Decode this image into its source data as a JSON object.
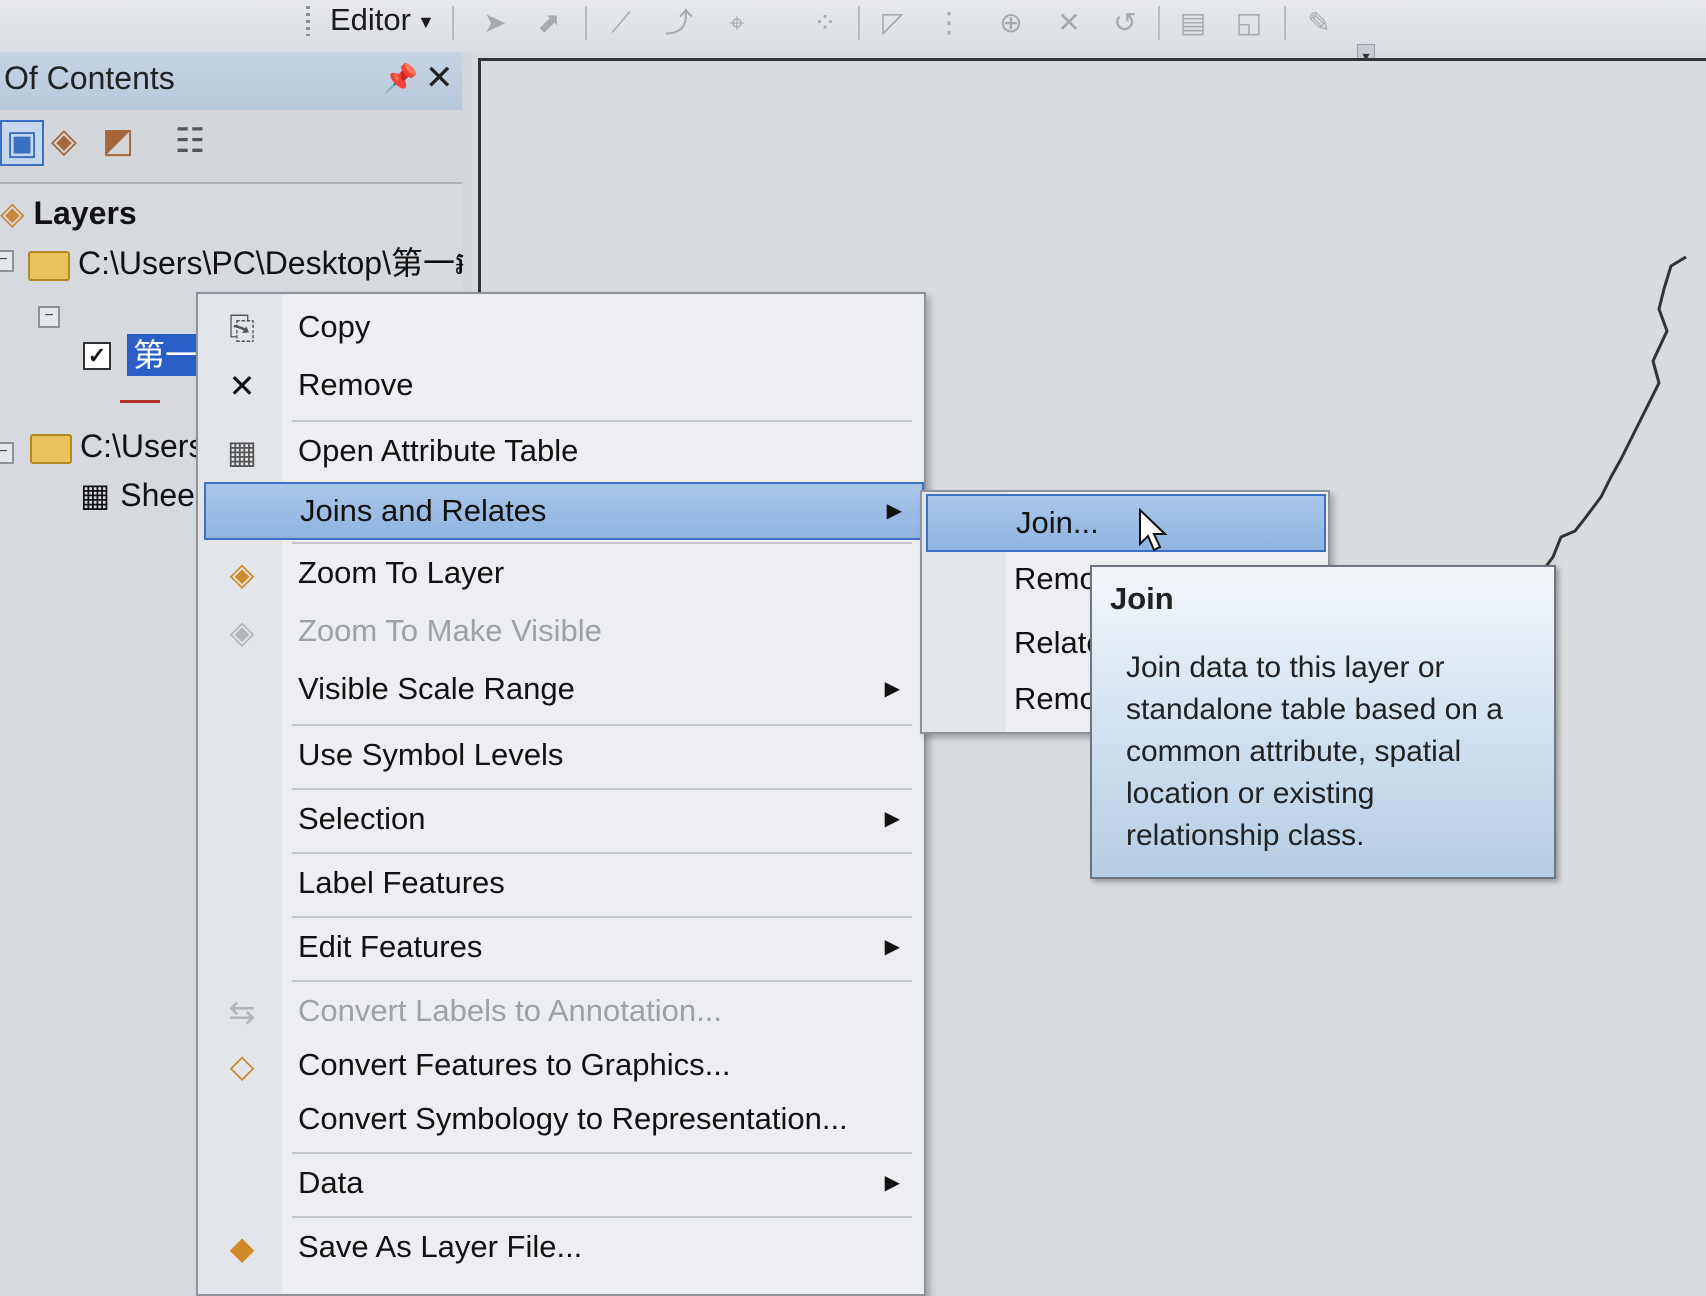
{
  "toolbar": {
    "editor_label": "Editor",
    "icons": [
      "edit-tool-icon",
      "edit-annotation-icon",
      "straight-segment-icon",
      "end-point-arc-icon",
      "trace-icon",
      "point-icon",
      "edit-vertices-icon",
      "reshape-icon",
      "cut-polygons-icon",
      "split-icon",
      "rotate-icon",
      "attributes-icon",
      "sketch-properties-icon",
      "editor-options-icon"
    ]
  },
  "toc": {
    "title": "Of Contents",
    "root_label": "Layers",
    "folder1_path": "C:\\Users\\PC\\Desktop\\第一៛",
    "layer_name": "第一",
    "folder2_path": "C:\\Users",
    "table_name": "Shee"
  },
  "context_menu": {
    "items": [
      {
        "label": "Copy",
        "icon": "copy-icon"
      },
      {
        "label": "Remove",
        "icon": "remove-icon"
      },
      {
        "label": "Open Attribute Table",
        "icon": "table-icon"
      },
      {
        "label": "Joins and Relates",
        "has_submenu": true
      },
      {
        "label": "Zoom To Layer",
        "icon": "zoom-layer-icon"
      },
      {
        "label": "Zoom To Make Visible",
        "icon": "zoom-visible-icon",
        "disabled": true
      },
      {
        "label": "Visible Scale Range",
        "has_submenu": true
      },
      {
        "label": "Use Symbol Levels"
      },
      {
        "label": "Selection",
        "has_submenu": true
      },
      {
        "label": "Label Features"
      },
      {
        "label": "Edit Features",
        "has_submenu": true
      },
      {
        "label": "Convert Labels to Annotation...",
        "icon": "convert-labels-icon",
        "disabled": true
      },
      {
        "label": "Convert Features to Graphics...",
        "icon": "convert-graphics-icon"
      },
      {
        "label": "Convert Symbology to Representation..."
      },
      {
        "label": "Data",
        "has_submenu": true
      },
      {
        "label": "Save As Layer File...",
        "icon": "layer-file-icon"
      }
    ]
  },
  "submenu": {
    "items": [
      "Join...",
      "Remo",
      "Relate",
      "Remo"
    ]
  },
  "tooltip": {
    "title": "Join",
    "body": "Join data to this layer or standalone table based on a common attribute, spatial location or existing relationship class."
  }
}
